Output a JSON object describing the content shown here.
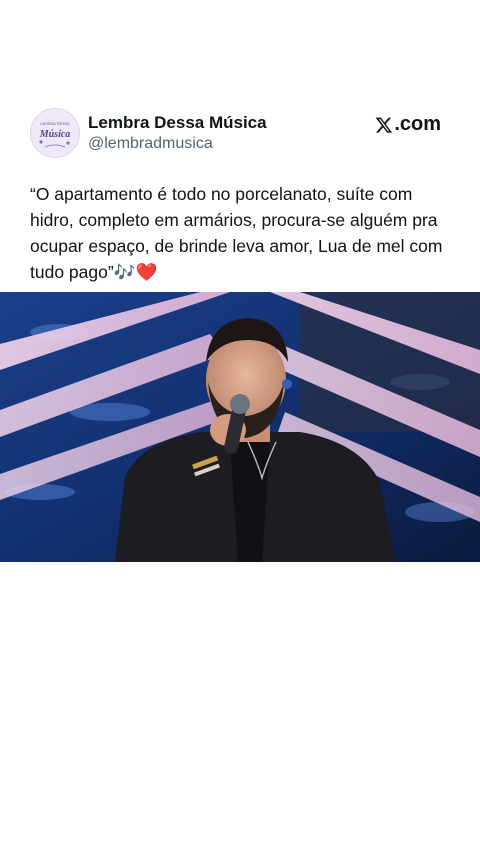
{
  "account": {
    "display_name": "Lembra Dessa Música",
    "handle": "@lembradmusica",
    "avatar_text": "Lembra Dessa Música"
  },
  "source": {
    "label": ".com",
    "icon": "x-logo-icon"
  },
  "tweet": {
    "text": "“O apartamento é todo no porcelanato, suíte com hidro, completo em armários, procura-se alguém pra ocupar espaço, de brinde leva amor, Lua de mel com tudo pago”",
    "emoji_music": "🎶",
    "emoji_heart": "❤️"
  },
  "media": {
    "type": "image",
    "description_icon": "singer-photo"
  },
  "colors": {
    "background": "#ffffff",
    "text": "#0f1419",
    "secondary_text": "#536471",
    "heart": "#e0245e"
  }
}
